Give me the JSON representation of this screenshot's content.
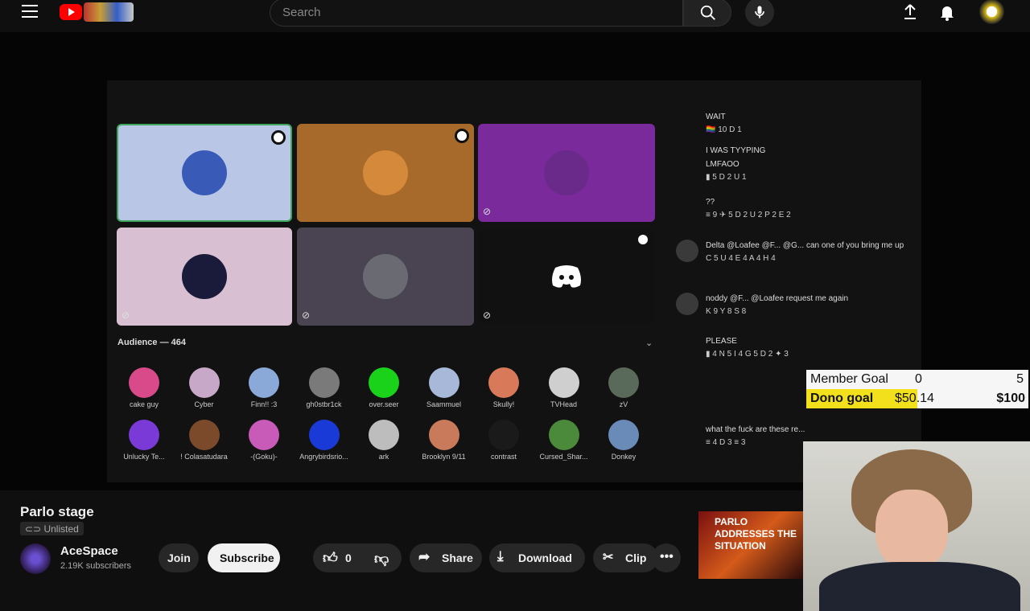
{
  "header": {
    "search_placeholder": "Search"
  },
  "stage": {
    "audience_label": "Audience — 464",
    "audience": [
      {
        "name": "cake guy",
        "color": "#d94a8a"
      },
      {
        "name": "Cyber",
        "color": "#c8a8c8"
      },
      {
        "name": "Finn!! :3",
        "color": "#8aa8d8"
      },
      {
        "name": "gh0stbr1ck",
        "color": "#7a7a7a"
      },
      {
        "name": "over.seer",
        "color": "#19d219"
      },
      {
        "name": "Saammuel",
        "color": "#a8b8d8"
      },
      {
        "name": "Skully!",
        "color": "#d87a5a"
      },
      {
        "name": "TVHead",
        "color": "#cfcfcf"
      },
      {
        "name": "zV",
        "color": "#5a6a5a"
      },
      {
        "name": "Unlucky Te...",
        "color": "#7a3ad8"
      },
      {
        "name": "! Colasatudara",
        "color": "#7a4a2a"
      },
      {
        "name": "-(Goku)-",
        "color": "#c85ab8"
      },
      {
        "name": "Angrybirdsrio...",
        "color": "#1a3ad8"
      },
      {
        "name": "ark",
        "color": "#bdbdbd"
      },
      {
        "name": "Brooklyn 9/11",
        "color": "#c87a5a"
      },
      {
        "name": "contrast",
        "color": "#1a1a1a"
      },
      {
        "name": "Cursed_Shar...",
        "color": "#4a8a3a"
      },
      {
        "name": "Donkey",
        "color": "#6a8ab8"
      }
    ]
  },
  "chat": {
    "messages": [
      {
        "text": "WAIT",
        "reactions": "🏳️‍🌈 10  D 1"
      },
      {
        "text": "I WAS TYYPING",
        "reactions": ""
      },
      {
        "text": "LMFAOO",
        "reactions": "▮ 5  D 2  U 1"
      },
      {
        "text": "??",
        "reactions": "≡ 9  ✈ 5  D 2  U 2  P 2  E 2"
      },
      {
        "text": "Delta  @Loafee @F... @G... can one of you bring me up",
        "reactions": "C 5  U 4  E 4  A 4  H 4"
      },
      {
        "text": "noddy  @F... @Loafee request me again",
        "reactions": "K 9  Y 8  S 8"
      },
      {
        "text": "PLEASE",
        "reactions": "▮ 4  N 5  I 4  G 5  D 2  ✦ 3"
      },
      {
        "text": "what the fuck are these re...",
        "reactions": "≡ 4  D 3  ≡ 3"
      }
    ]
  },
  "overlay": {
    "member_goal_label": "Member Goal",
    "member_goal_current": "0",
    "member_goal_target": "5",
    "member_goal_progress": 0,
    "dono_goal_label": "Dono goal",
    "dono_goal_current": "$50.14",
    "dono_goal_target": "$100",
    "dono_goal_progress": 0.5014
  },
  "video": {
    "title": "Parlo stage",
    "visibility": "Unlisted"
  },
  "channel": {
    "name": "AceSpace",
    "subscribers": "2.19K subscribers"
  },
  "actions": {
    "join": "Join",
    "subscribe": "Subscribe",
    "likes": "0",
    "share": "Share",
    "download": "Download",
    "clip": "Clip"
  },
  "sidebar_thumb": {
    "title": "PARLO ADDRESSES THE SITUATION"
  }
}
